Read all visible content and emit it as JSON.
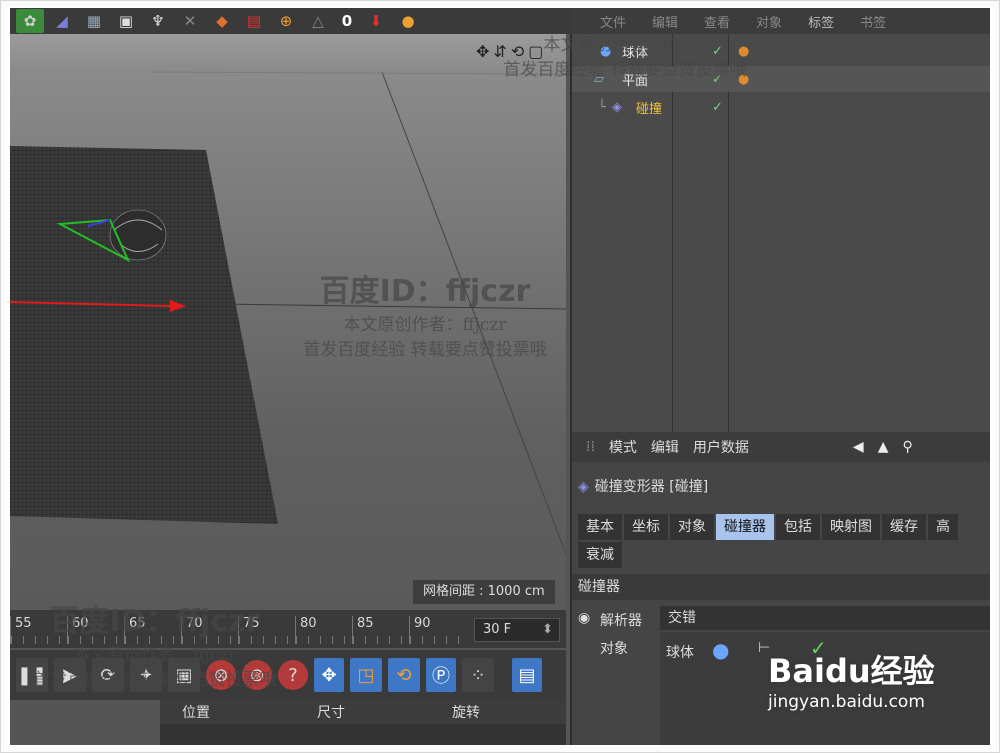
{
  "toolbar": {
    "icons": [
      "sphere-icon",
      "pill-icon",
      "grid-icon",
      "camera-icon",
      "light-icon",
      "path-icon",
      "cube-icon",
      "tag-icon",
      "axis-icon",
      "coord-icon"
    ],
    "counter": "0"
  },
  "menubar": {
    "items": [
      "文件",
      "编辑",
      "查看",
      "对象",
      "标签",
      "书签"
    ]
  },
  "viewport": {
    "grid_spacing": "网格间距 : 1000 cm"
  },
  "timeline": {
    "ticks": [
      "55",
      "60",
      "65",
      "70",
      "75",
      "80",
      "85",
      "90"
    ],
    "frame": "30 F"
  },
  "coords": {
    "position": "位置",
    "size": "尺寸",
    "rotation": "旋转"
  },
  "objects": [
    {
      "name": "球体",
      "color": "#e6e6e6"
    },
    {
      "name": "平面",
      "color": "#e6e6e6"
    },
    {
      "name": "碰撞",
      "color": "#f1c232"
    }
  ],
  "attributes": {
    "menu": [
      "模式",
      "编辑",
      "用户数据"
    ],
    "title": "碰撞变形器 [碰撞]",
    "tabs": [
      "基本",
      "坐标",
      "对象",
      "碰撞器",
      "包括",
      "映射图",
      "缓存",
      "高",
      "衰减"
    ],
    "active_tab": "碰撞器",
    "section": "碰撞器",
    "solver_label": "解析器",
    "solver_value": "交错",
    "object_label": "对象",
    "object_value": "球体"
  },
  "watermark": {
    "id_text": "百度ID：ffjczr",
    "line1": "本文原创作者：ffjczr",
    "line2": "首发百度经验 转载要点赞投票哦"
  },
  "baidu": {
    "logo": "Baidu经验",
    "url": "jingyan.baidu.com"
  }
}
